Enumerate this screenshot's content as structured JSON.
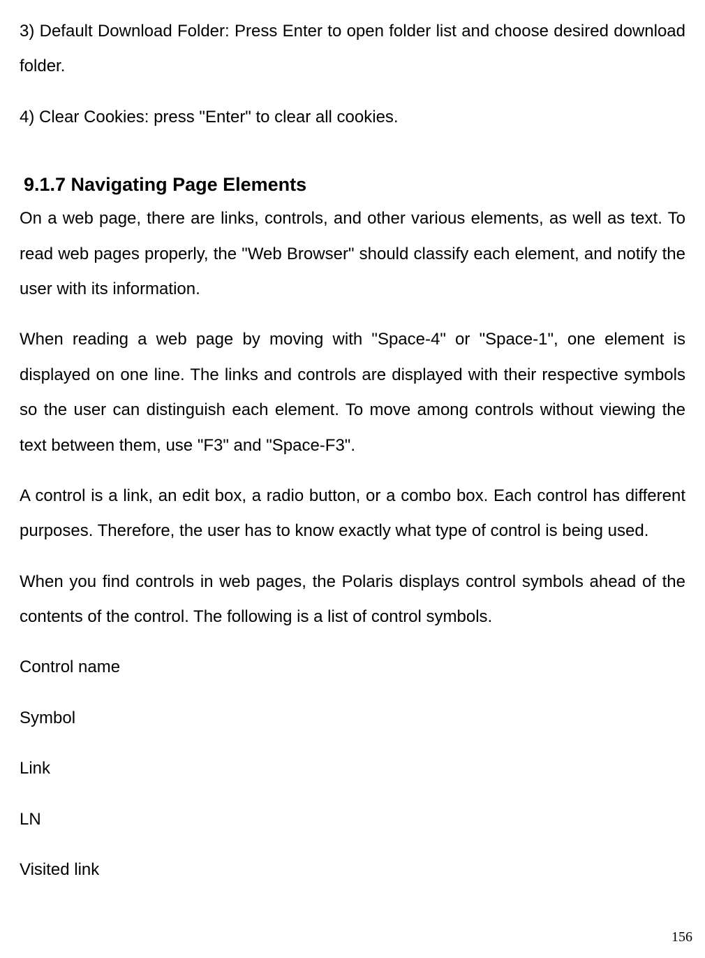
{
  "paragraphs": {
    "p1": "3) Default Download Folder: Press Enter to open folder list and choose desired download folder.",
    "p2": "4) Clear Cookies: press \"Enter\" to clear all cookies.",
    "heading": "9.1.7 Navigating Page Elements",
    "p3": "On a web page, there are links, controls, and other various elements, as well as text. To read web pages properly, the \"Web Browser\" should classify each element, and notify the user with its information.",
    "p4": "When reading a web page by moving with \"Space-4\" or \"Space-1\", one element is displayed on one line. The links and controls are displayed with their respective symbols so the user can distinguish each element. To move among controls without viewing the text between them, use \"F3\" and \"Space-F3\".",
    "p5": "A control is a link, an edit box, a radio button, or a combo box. Each control has different purposes. Therefore, the user has to know exactly what type of control is being used.",
    "p6": "When you find controls in web pages, the Polaris displays control symbols ahead of the contents of the control. The following is a list of control symbols.",
    "item1": "Control name",
    "item2": "Symbol",
    "item3": "Link",
    "item4": "LN",
    "item5": "Visited link"
  },
  "page_number": "156"
}
